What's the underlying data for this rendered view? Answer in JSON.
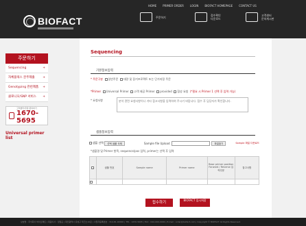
{
  "header": {
    "top_links": [
      "HOME",
      "PRIMER ORDER",
      "LOGIN",
      "BIOFACT HOMEPAGE",
      "CONTACT US"
    ],
    "logo_text": "BIOFACT",
    "tools": [
      {
        "icon": "cart-icon",
        "label": "주문하기"
      },
      {
        "icon": "document-icon",
        "label1": "접수확인",
        "label2": "다운로드"
      },
      {
        "icon": "chat-icon",
        "label1": "고객센터",
        "label2": "문의게시판"
      }
    ]
  },
  "sidebar": {
    "title": "주문하기",
    "items": [
      {
        "label": "Sequencing",
        "plus": "+"
      },
      {
        "label": "자체플렉스 분주제출",
        "plus": "+"
      },
      {
        "label": "Genotyping 관련제품",
        "plus": "+"
      },
      {
        "label": "클로니오/SNP 서비스",
        "plus": "+"
      }
    ],
    "phone_caption": "고객센터/주문 문의하기",
    "phone": "1670-5695",
    "universal_link": "Universal primer list"
  },
  "main": {
    "title": "Sequencing",
    "section1_label": "기본정보입력",
    "order_type_label": "* 주문구분",
    "order_type_options": [
      "일반주문",
      "대량 및 장기프로젝트 또는 단가지정 주문"
    ],
    "primer_label": "*Primer",
    "primer_options": [
      "Universal Primer",
      "고객 제공 Primer",
      "provided",
      "합성 요청"
    ],
    "primer_note": "(*필요 시 Primer 1 선택 후 입력 가능)",
    "request_label": "* 요청사항",
    "request_placeholder": "분석 관련 요청사항이나 기타 참고사항을 입력하여 주시기 바랍니다. 접수 후 담당자가 확인합니다.",
    "section2_label": "샘플정보입력",
    "select_all_label": "샘플 선택",
    "delete_label": "선택 샘플 삭제",
    "upload_label": "Sample file Upload",
    "browse_label": "파일찾기",
    "sample_download_label": "Sample 파일 다운로드",
    "sample_note": "*샘플명 및 Primer 항목, sequence/pos 입력, primer는 선택 후 입력",
    "table_headers": [
      "샘플 번호",
      "Sample name",
      "Primer name",
      "Base primer position Forward / Reverse 입력주문",
      "참고사항"
    ],
    "submit_label": "접수하기",
    "submit2_label": "BIOFACT 임시저장"
  },
  "footer": {
    "text": "상호명 : 주식회사 바이오팩트 | 대표이사 : 정일훈 | 대전광역시 유성구 테크노10로 | 사업자등록번호 : 314-81-00000 | TEL : 1670-5695 | FAX : 042-000-0000 | E-mail : order@biofact.com | Copyright © BIOFACT All Rights Reserved."
  },
  "colors": {
    "brand_red": "#b3121f",
    "header_bg": "#262626"
  }
}
